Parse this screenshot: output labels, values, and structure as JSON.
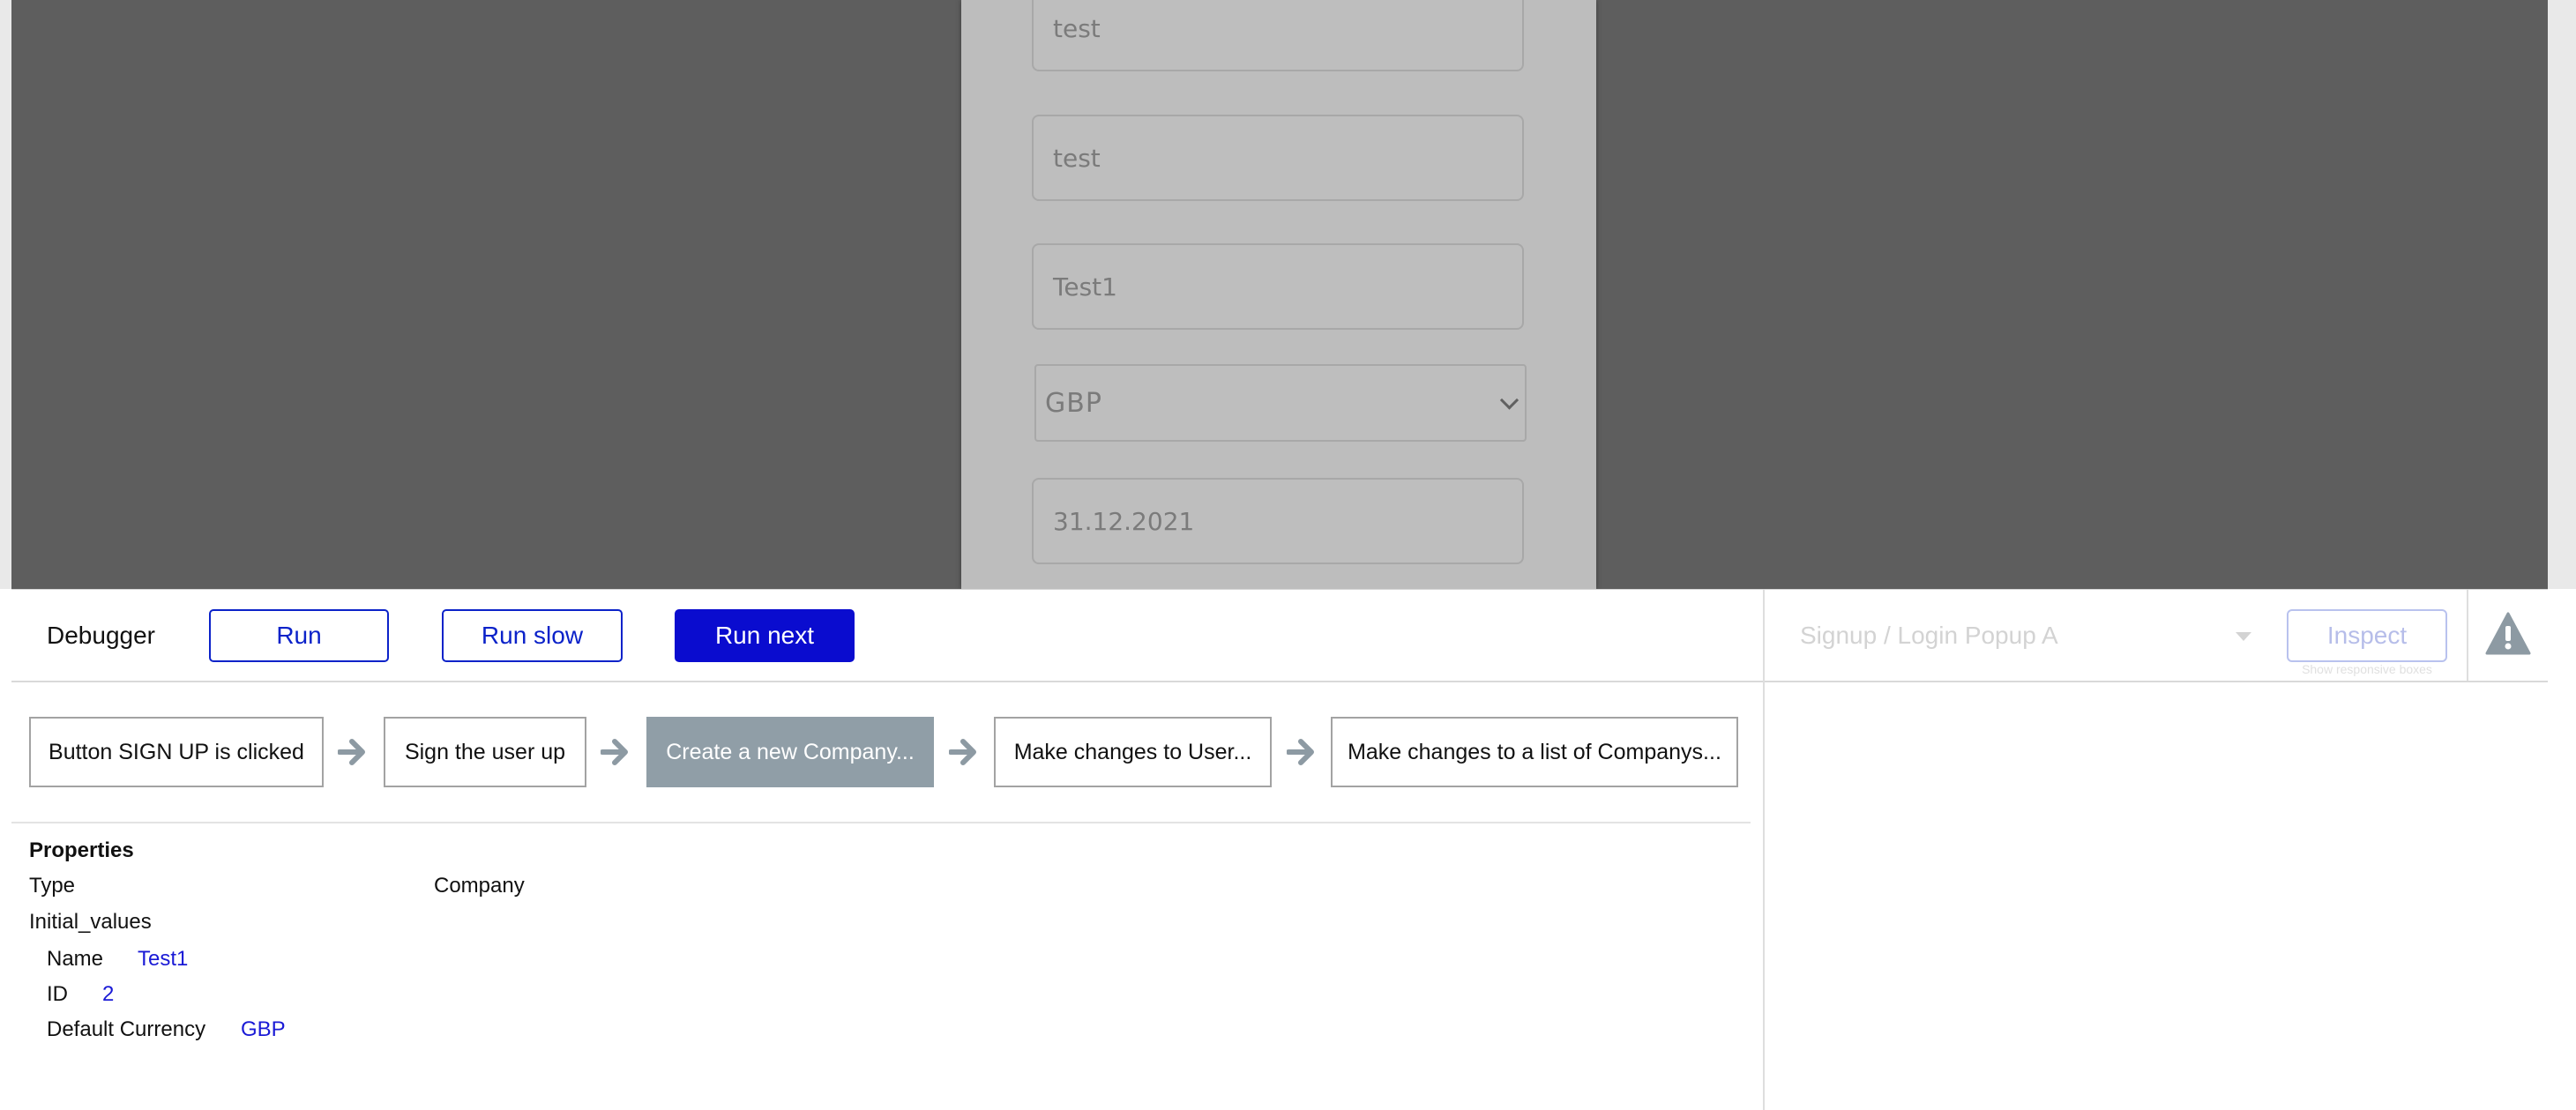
{
  "preview": {
    "fields": [
      {
        "value": "test"
      },
      {
        "value": "test"
      },
      {
        "value": "Test1"
      },
      {
        "value": "GBP"
      },
      {
        "value": "31.12.2021"
      }
    ]
  },
  "toolbar": {
    "title": "Debugger",
    "run_label": "Run",
    "run_slow_label": "Run slow",
    "run_next_label": "Run next",
    "page_select_value": "Signup / Login Popup A",
    "inspect_label": "Inspect",
    "inspect_hint": "Show responsive boxes",
    "warning_icon": "warning-icon"
  },
  "steps": [
    {
      "label": "Button SIGN UP is clicked",
      "active": false
    },
    {
      "label": "Sign the user up",
      "active": false
    },
    {
      "label": "Create a new Company...",
      "active": true
    },
    {
      "label": "Make changes to User...",
      "active": false
    },
    {
      "label": "Make changes to a list of Companys...",
      "active": false
    }
  ],
  "properties": {
    "heading": "Properties",
    "type_label": "Type",
    "type_value": "Company",
    "initial_values_label": "Initial_values",
    "items": [
      {
        "label": "Name",
        "value": "Test1"
      },
      {
        "label": "ID",
        "value": "2"
      },
      {
        "label": "Default Currency",
        "value": "GBP"
      }
    ]
  },
  "colors": {
    "accent": "#0a0ccf",
    "active_step": "#909ea7",
    "preview_bg": "#5e5e5e"
  }
}
